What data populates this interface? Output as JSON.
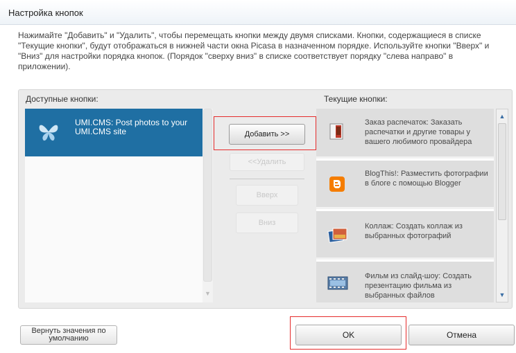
{
  "window": {
    "title": "Настройка кнопок"
  },
  "description": "Нажимайте \"Добавить\" и \"Удалить\", чтобы перемещать кнопки между двумя списками. Кнопки, содержащиеся в списке \"Текущие кнопки\", будут отображаться в нижней части окна Picasa в назначенном порядке. Используйте кнопки \"Вверх\" и \"Вниз\" для настройки порядка кнопок. (Порядок \"сверху вниз\" в списке соответствует порядку \"слева направо\" в приложении).",
  "available": {
    "label": "Доступные кнопки:",
    "items": [
      {
        "text": "UMI.CMS:  Post photos to your UMI.CMS site",
        "icon": "butterfly-icon",
        "selected": true
      }
    ]
  },
  "current": {
    "label": "Текущие кнопки:",
    "items": [
      {
        "text": "Заказ распечаток:  Заказать распечатки и другие товары у вашего любимого провайдера",
        "icon": "print-order-icon"
      },
      {
        "text": "BlogThis!:  Разместить фотографии в блоге с помощью Blogger",
        "icon": "blogger-icon"
      },
      {
        "text": "Коллаж:  Создать коллаж из выбранных фотографий",
        "icon": "collage-icon"
      },
      {
        "text": "Фильм из слайд-шоу:  Создать презентацию фильма из выбранных файлов",
        "icon": "film-icon"
      }
    ]
  },
  "actions": {
    "add": "Добавить >>",
    "remove": "<<Удалить",
    "up": "Вверх",
    "down": "Вниз"
  },
  "footer": {
    "defaults": "Вернуть значения по умолчанию",
    "ok": "OK",
    "cancel": "Отмена"
  },
  "colors": {
    "selection": "#1f6fa3",
    "highlight_box": "#e52b2b",
    "blogger": "#f57d00"
  }
}
